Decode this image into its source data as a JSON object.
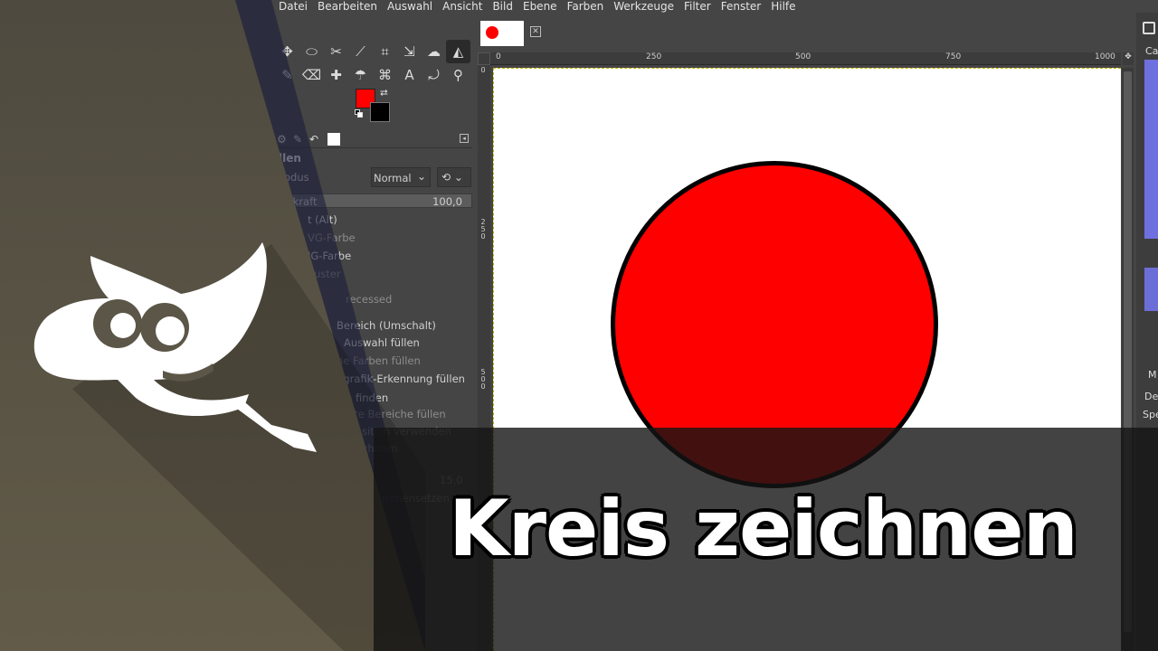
{
  "menubar": {
    "items": [
      "Datei",
      "Bearbeiten",
      "Auswahl",
      "Ansicht",
      "Bild",
      "Ebene",
      "Farben",
      "Werkzeuge",
      "Filter",
      "Fenster",
      "Hilfe"
    ]
  },
  "toolbox": {
    "tools": [
      {
        "name": "move-tool-icon",
        "glyph": "✥"
      },
      {
        "name": "free-select-tool-icon",
        "glyph": "⬭"
      },
      {
        "name": "scissors-tool-icon",
        "glyph": "✂"
      },
      {
        "name": "fuzzy-select-tool-icon",
        "glyph": "⟋"
      },
      {
        "name": "crop-tool-icon",
        "glyph": "⌗"
      },
      {
        "name": "transform-tool-icon",
        "glyph": "⇲"
      },
      {
        "name": "warp-tool-icon",
        "glyph": "☁"
      },
      {
        "name": "bucket-fill-tool-icon",
        "glyph": "◭"
      },
      {
        "name": "paintbrush-tool-icon",
        "glyph": "✎"
      },
      {
        "name": "eraser-tool-icon",
        "glyph": "⌫"
      },
      {
        "name": "heal-tool-icon",
        "glyph": "✚"
      },
      {
        "name": "smudge-tool-icon",
        "glyph": "☂"
      },
      {
        "name": "paths-tool-icon",
        "glyph": "⌘"
      },
      {
        "name": "text-tool-icon",
        "glyph": "A"
      },
      {
        "name": "color-picker-tool-icon",
        "glyph": "⤾"
      },
      {
        "name": "zoom-tool-icon",
        "glyph": "⚲"
      }
    ],
    "active_tool": "bucket-fill-tool-icon",
    "fg_color": "#ff0000",
    "bg_color": "#000000"
  },
  "tool_options": {
    "title": "llen",
    "mode_label": "odus",
    "mode_value": "Normal",
    "opacity_label": "kkraft",
    "opacity_value": "100,0",
    "rows": [
      {
        "text": "t  (Alt)",
        "dim": false
      },
      {
        "text": "VG-Farbe",
        "dim": true
      },
      {
        "text": "IG-Farbe",
        "dim": false
      },
      {
        "text": "uster",
        "dim": true
      },
      {
        "text": "recessed",
        "dim": true
      },
      {
        "text": "Bereich (Umschalt)",
        "dim": false
      },
      {
        "text": "Auswahl füllen",
        "dim": false
      },
      {
        "text": "ne Farben füllen",
        "dim": true
      },
      {
        "text": "ngrafik-Erkennung füllen",
        "dim": false
      },
      {
        "text": "n finden",
        "dim": false
      },
      {
        "text": "nte Bereiche füllen",
        "dim": true
      },
      {
        "text": "sition verwenden",
        "dim": true
      },
      {
        "text": "chbarn",
        "dim": true
      },
      {
        "text": "15,0",
        "dim": true
      },
      {
        "text": "mmensetzen",
        "dim": true
      }
    ]
  },
  "canvas": {
    "ruler_h": [
      "0",
      "250",
      "500",
      "750",
      "1000"
    ],
    "ruler_v": [
      "0",
      "2 5 0",
      "5 0 0"
    ],
    "image_bg": "#ffffff",
    "circle_fill": "#ff0000",
    "circle_stroke": "#000000"
  },
  "right_dock": {
    "label1": "Ca",
    "label2": "M",
    "label3": "De",
    "label4": "Spe"
  },
  "overlay": {
    "caption": "Kreis zeichnen",
    "panel_color": "#5b5647"
  }
}
